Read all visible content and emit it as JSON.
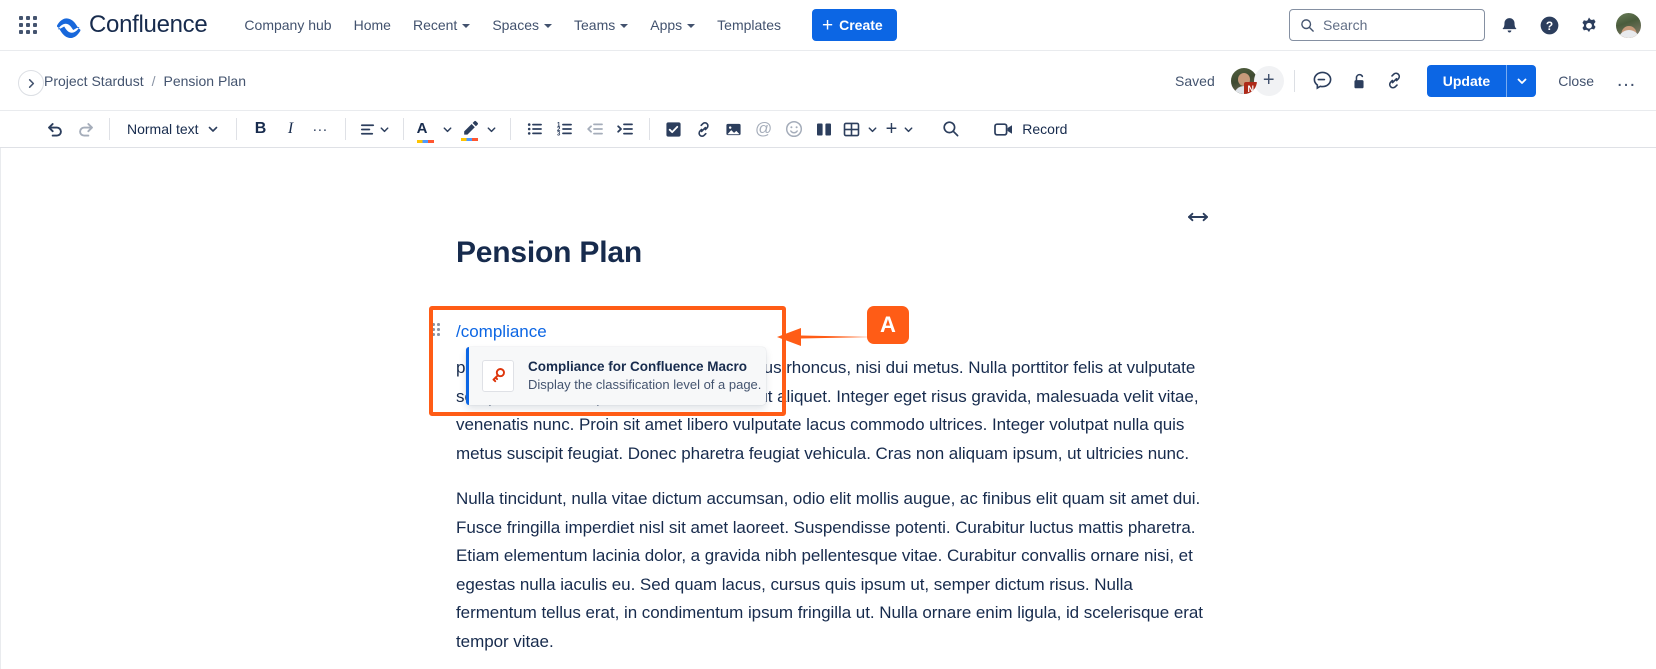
{
  "topnav": {
    "app_switcher": "app-switcher",
    "brand": "Confluence",
    "links": [
      {
        "label": "Company hub",
        "has_caret": false
      },
      {
        "label": "Home",
        "has_caret": false
      },
      {
        "label": "Recent",
        "has_caret": true
      },
      {
        "label": "Spaces",
        "has_caret": true
      },
      {
        "label": "Teams",
        "has_caret": true
      },
      {
        "label": "Apps",
        "has_caret": true
      },
      {
        "label": "Templates",
        "has_caret": false
      }
    ],
    "create_label": "Create",
    "create_plus": "+",
    "search_placeholder": "Search",
    "icons": [
      "notifications-icon",
      "help-icon",
      "settings-icon",
      "profile-avatar"
    ]
  },
  "header": {
    "expand_sidebar": "expand-sidebar-icon",
    "breadcrumb": {
      "space": "Project Stardust",
      "separator": "/",
      "page": "Pension Plan"
    },
    "saved_status": "Saved",
    "collaborator_badge": "N",
    "add_collaborator": "+",
    "comment_icon": "comment-icon",
    "restrictions_icon": "unlocked-padlock-icon",
    "copy_link_icon": "link-icon",
    "update_label": "Update",
    "update_dropdown": "chevron-down-icon",
    "close_label": "Close",
    "more_actions": "…"
  },
  "toolbar": {
    "undo": "undo-icon",
    "redo": "redo-icon",
    "text_style": "Normal text",
    "bold": "B",
    "italic": "I",
    "more_formatting": "…",
    "align": "text-align-icon",
    "text_color": "A",
    "highlight": "highlight-icon",
    "bullet_list": "bullet-list-icon",
    "numbered_list": "numbered-list-icon",
    "outdent": "outdent-icon",
    "indent": "indent-icon",
    "action_item": "task-checkbox-icon",
    "link": "link-icon",
    "image": "image-icon",
    "mention": "@",
    "emoji": "emoji-icon",
    "layout": "layouts-icon",
    "table": "table-icon",
    "insert_more": "+",
    "find_replace": "search-icon",
    "record_label": "Record",
    "record_icon": "video-camera-icon"
  },
  "page": {
    "title": "Pension Plan",
    "width_toggle": "width-adjust-icon",
    "slash_command": "/compliance",
    "macro_suggestion": {
      "icon": "key-icon",
      "title": "Compliance for Confluence Macro",
      "description": "Display the classification level of a page."
    },
    "paragraphs": [
      "piscing elit. Vestibulum viverra, ex et finibus rhoncus, nisi dui metus. Nulla porttitor felis at vulputate semper. Pellentesque bibendum at eros ut aliquet. Integer eget risus gravida, malesuada velit vitae, venenatis nunc. Proin sit amet libero vulputate lacus commodo ultrices. Integer volutpat nulla quis metus suscipit feugiat. Donec pharetra feugiat vehicula. Cras non aliquam ipsum, ut ultricies nunc.",
      "Nulla tincidunt, nulla vitae dictum accumsan, odio elit mollis augue, ac finibus elit quam sit amet dui. Fusce fringilla imperdiet nisl sit amet laoreet. Suspendisse potenti. Curabitur luctus mattis pharetra. Etiam elementum lacinia dolor, a gravida nibh pellentesque vitae. Curabitur convallis ornare nisi, et egestas nulla iaculis eu. Sed quam lacus, cursus quis ipsum ut, semper dictum risus. Nulla fermentum tellus erat, in condimentum ipsum fringilla ut. Nulla ornare enim ligula, id scelerisque erat tempor vitae."
    ]
  },
  "annotation": {
    "label": "A",
    "color": "#ff5c16",
    "target": "slash-command-macro-suggestion"
  },
  "colors": {
    "brand_blue": "#0c66e4",
    "text": "#172b4d",
    "subtle_text": "#44546f",
    "annotation_orange": "#ff5c16"
  }
}
